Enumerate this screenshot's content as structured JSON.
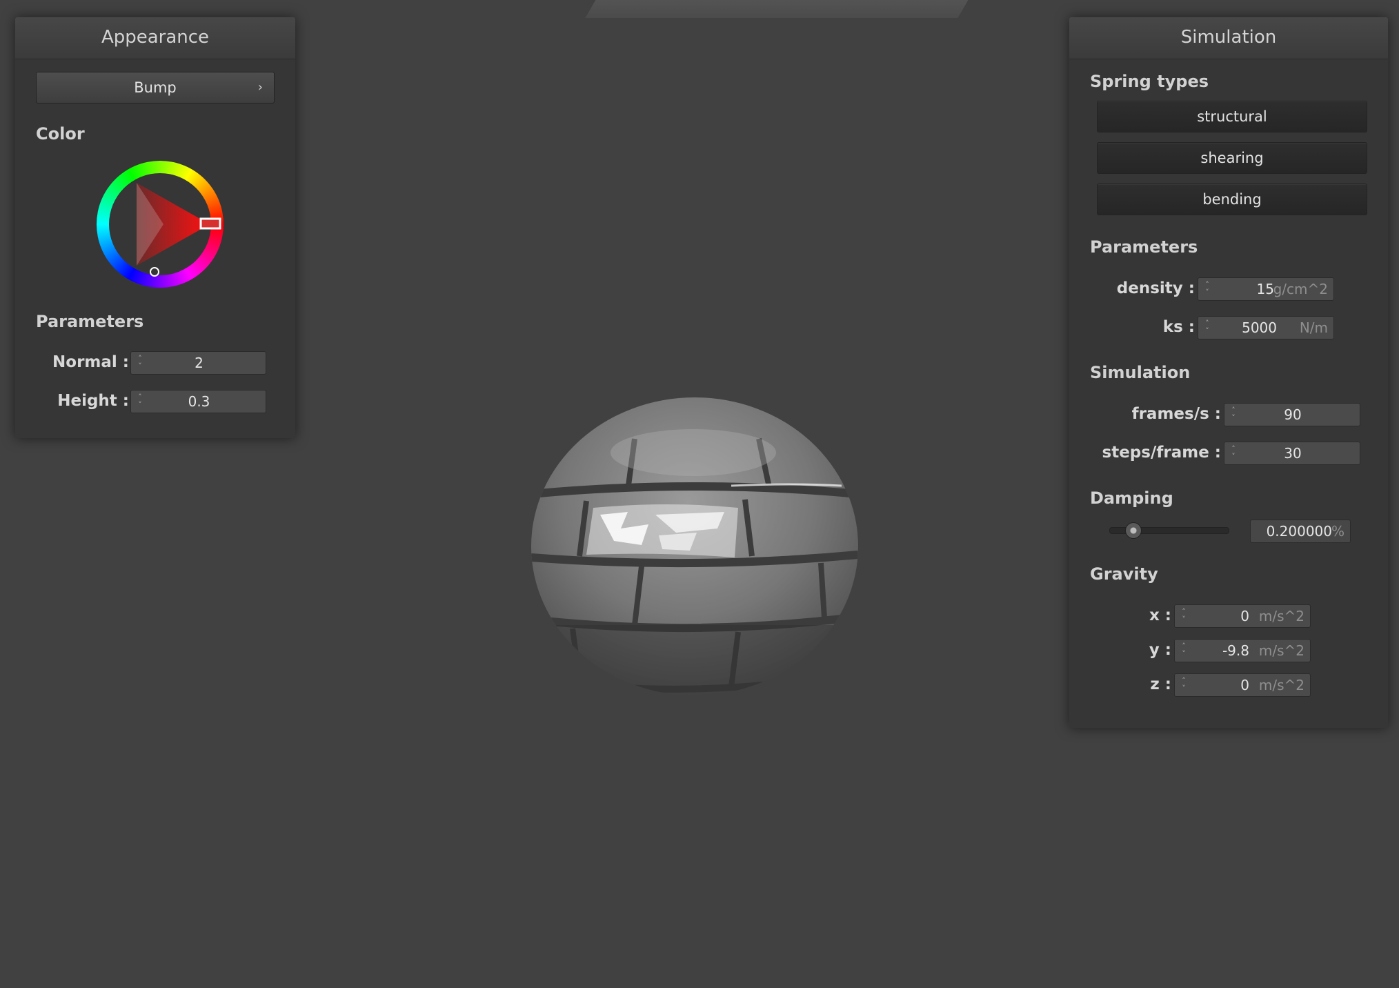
{
  "appearance": {
    "title": "Appearance",
    "shader_select": "Bump",
    "color_label": "Color",
    "color_value": "#ff0000",
    "params_label": "Parameters",
    "normal_label": "Normal :",
    "normal_value": "2",
    "height_label": "Height :",
    "height_value": "0.3"
  },
  "simulation": {
    "title": "Simulation",
    "spring_types_label": "Spring types",
    "spring_types": [
      "structural",
      "shearing",
      "bending"
    ],
    "params_label": "Parameters",
    "density_label": "density :",
    "density_value": "15",
    "density_unit": "g/cm^2",
    "ks_label": "ks :",
    "ks_value": "5000",
    "ks_unit": "N/m",
    "sim_label": "Simulation",
    "fps_label": "frames/s :",
    "fps_value": "90",
    "steps_label": "steps/frame :",
    "steps_value": "30",
    "damping_label": "Damping",
    "damping_value": "0.200000",
    "damping_unit": "%",
    "damping_fraction": 0.2,
    "gravity_label": "Gravity",
    "gx_label": "x :",
    "gx_value": "0",
    "gy_label": "y :",
    "gy_value": "-9.8",
    "gz_label": "z :",
    "gz_value": "0",
    "gravity_unit": "m/s^2"
  },
  "colors": {
    "background": "#414141",
    "panel": "#363636"
  },
  "icons": {
    "dropdown": "chevron-right-icon",
    "spinner": "spinner-arrows-icon"
  }
}
